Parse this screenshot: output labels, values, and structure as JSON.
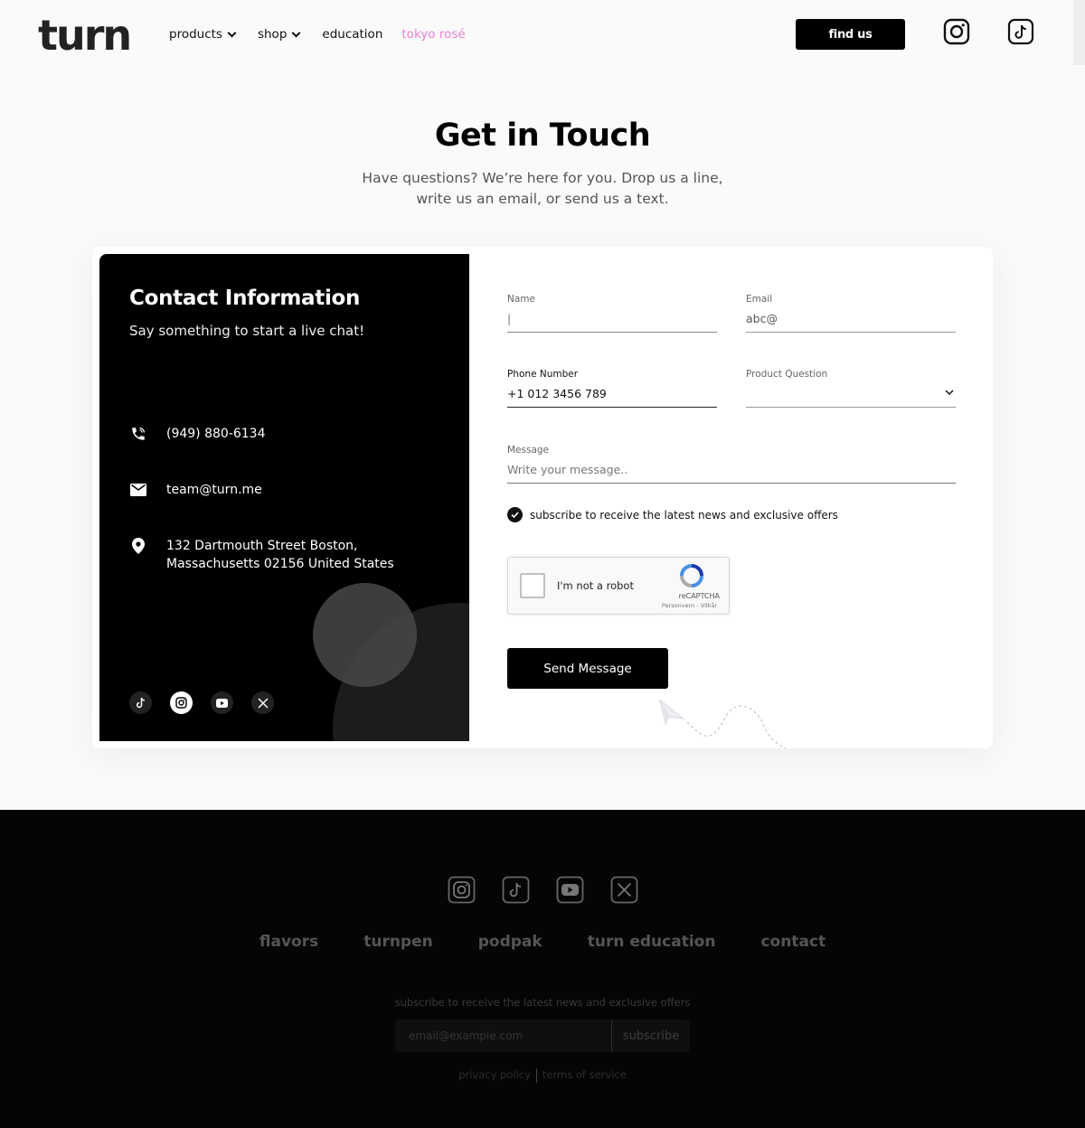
{
  "header": {
    "logo": "turn",
    "nav": [
      {
        "label": "products",
        "dropdown": true
      },
      {
        "label": "shop",
        "dropdown": true
      },
      {
        "label": "education",
        "dropdown": false
      },
      {
        "label": "tokyo rosé",
        "dropdown": false
      }
    ],
    "find_us_label": "find us",
    "icons": [
      "instagram-icon",
      "tiktok-icon"
    ]
  },
  "hero": {
    "title": "Get in Touch",
    "subtitle_line1": "Have questions? We’re here for you. Drop us a line,",
    "subtitle_line2": "write us an email, or send us a text."
  },
  "contact_info": {
    "title": "Contact Information",
    "subtitle": "Say something to start a live chat!",
    "phone": "(949) 880-6134",
    "email": "team@turn.me",
    "address_line1": "132 Dartmouth Street Boston,",
    "address_line2": "Massachusetts 02156 United States",
    "socials": [
      "tiktok-icon",
      "instagram-icon",
      "youtube-icon",
      "x-icon"
    ]
  },
  "form": {
    "name_label": "Name",
    "name_value": "|",
    "email_label": "Email",
    "email_value": "abc@",
    "phone_label": "Phone Number",
    "phone_value": "+1 012 3456 789",
    "product_label": "Product Question",
    "product_value": "",
    "message_label": "Message",
    "message_placeholder": "Write your message..",
    "subscribe_label": "subscribe to receive the latest news and exclusive offers",
    "subscribe_checked": true,
    "captcha_text": "I'm not a robot",
    "captcha_brand": "reCAPTCHA",
    "captcha_links": "Personvern - Vilkår",
    "send_label": "Send Message"
  },
  "footer": {
    "icons": [
      "instagram-icon",
      "tiktok-icon",
      "youtube-icon",
      "x-icon"
    ],
    "links": [
      "flavors",
      "turnpen",
      "podpak",
      "turn education",
      "contact"
    ],
    "subscribe_text": "subscribe to receive the latest news and exclusive offers",
    "email_placeholder": "email@example.com",
    "subscribe_button": "subscribe",
    "privacy": "privacy policy",
    "terms": "terms of service"
  },
  "colors": {
    "accent_pink": "#ea7ed3",
    "primary": "#000000",
    "background": "#fafafa"
  }
}
